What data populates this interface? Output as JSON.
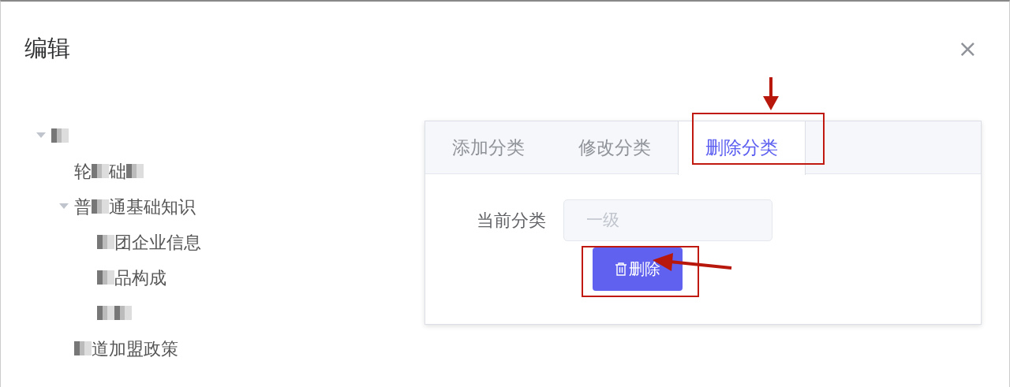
{
  "dialog": {
    "title": "编辑",
    "close_label": "×"
  },
  "tree": [
    {
      "expanded": true,
      "segments": [
        {
          "kind": "mask"
        }
      ],
      "children": [
        {
          "segments": [
            {
              "kind": "text",
              "text": "轮"
            },
            {
              "kind": "mask"
            },
            {
              "kind": "text",
              "text": "础"
            },
            {
              "kind": "mask"
            }
          ]
        },
        {
          "expanded": true,
          "segments": [
            {
              "kind": "text",
              "text": "普"
            },
            {
              "kind": "mask"
            },
            {
              "kind": "text",
              "text": "通基础知识"
            }
          ],
          "children": [
            {
              "segments": [
                {
                  "kind": "mask"
                },
                {
                  "kind": "text",
                  "text": "团企业信息"
                }
              ]
            },
            {
              "segments": [
                {
                  "kind": "mask"
                },
                {
                  "kind": "text",
                  "text": "品构成"
                }
              ]
            },
            {
              "segments": [
                {
                  "kind": "mask"
                },
                {
                  "kind": "mask"
                }
              ]
            }
          ]
        },
        {
          "segments": [
            {
              "kind": "mask"
            },
            {
              "kind": "text",
              "text": "道加盟政策"
            }
          ]
        }
      ]
    }
  ],
  "tabs": [
    {
      "label": "添加分类",
      "selected": false
    },
    {
      "label": "修改分类",
      "selected": false
    },
    {
      "label": "删除分类",
      "selected": true
    }
  ],
  "form": {
    "label": "当前分类",
    "value": "一级",
    "disabled": true
  },
  "button": {
    "label": "删除"
  }
}
